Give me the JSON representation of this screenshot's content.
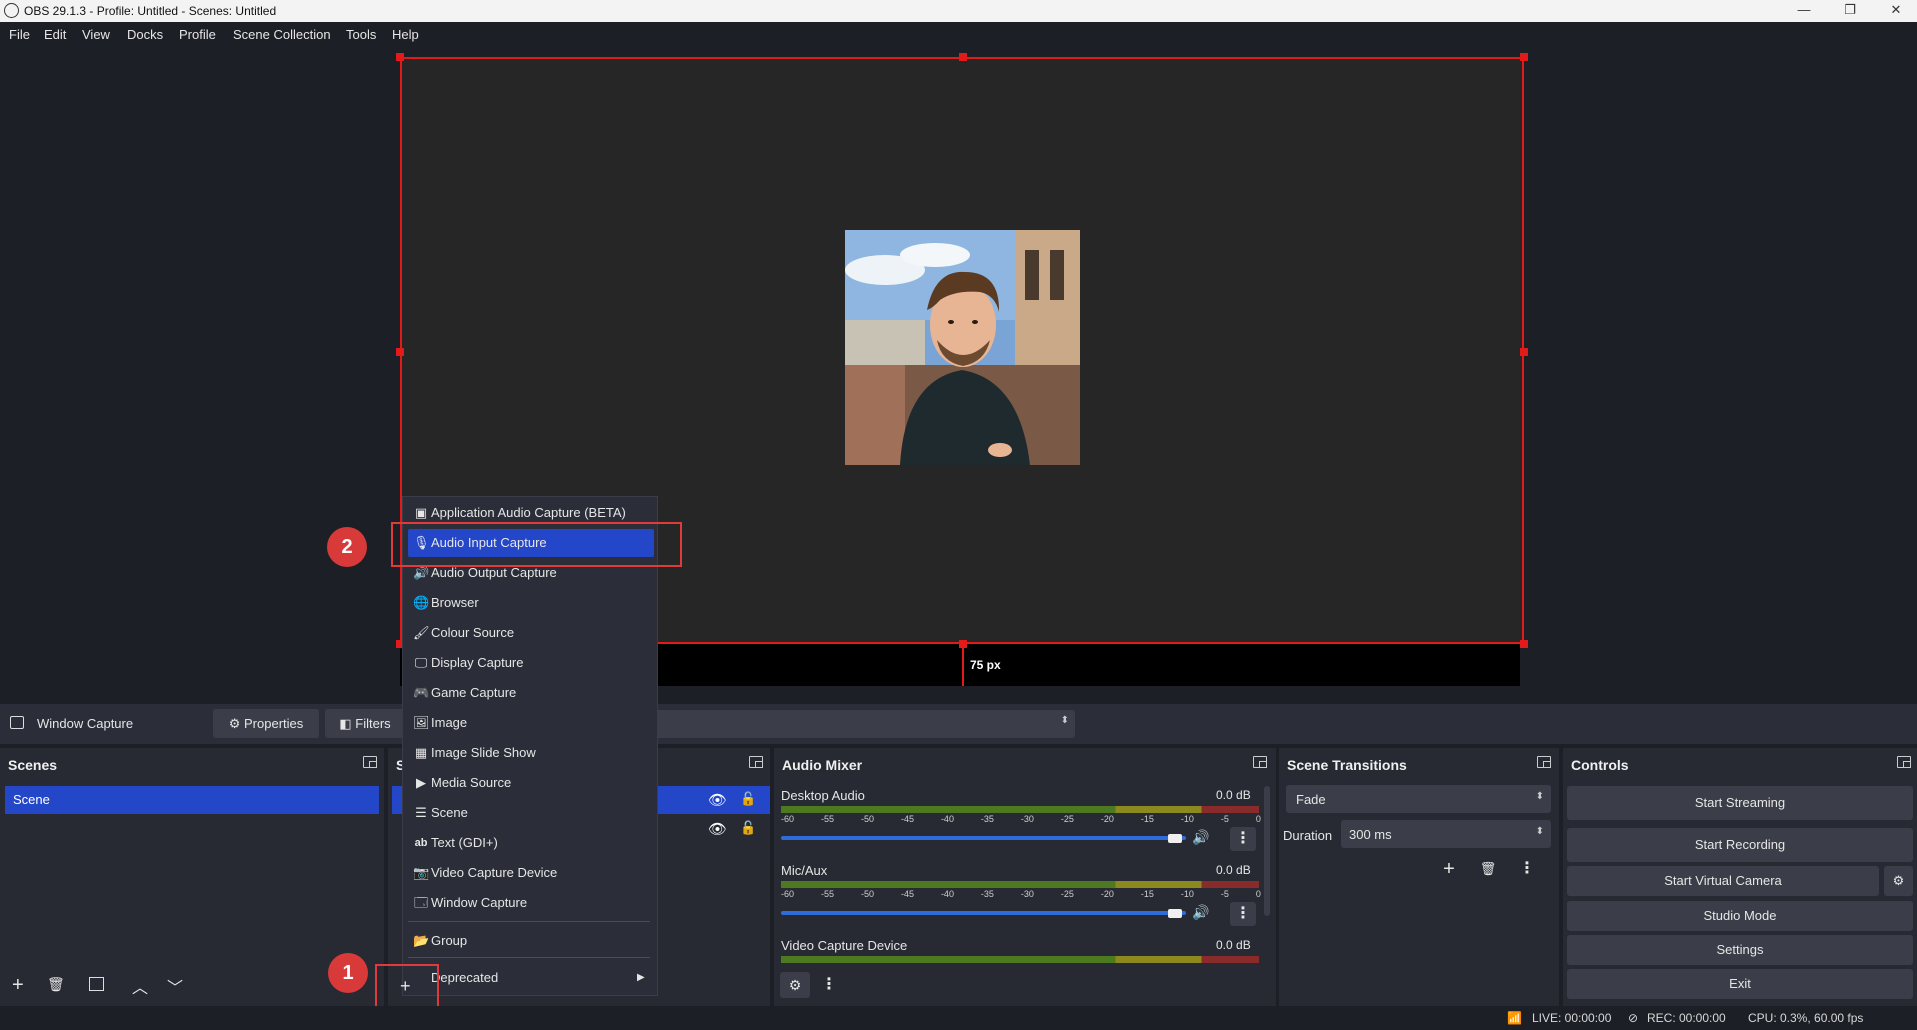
{
  "window": {
    "title": "OBS 29.1.3 - Profile: Untitled - Scenes: Untitled",
    "minimize": "—",
    "maximize": "❐",
    "close": "✕"
  },
  "menubar": [
    "File",
    "Edit",
    "View",
    "Docks",
    "Profile",
    "Scene Collection",
    "Tools",
    "Help"
  ],
  "preview": {
    "guide_label": "75 px"
  },
  "source_toolbar": {
    "selected_source": "Window Capture",
    "properties": "Properties",
    "filters": "Filters"
  },
  "scenes": {
    "title": "Scenes",
    "items": [
      "Scene"
    ]
  },
  "sources": {
    "title": "S"
  },
  "audio_mixer": {
    "title": "Audio Mixer",
    "scale": [
      "-60",
      "-55",
      "-50",
      "-45",
      "-40",
      "-35",
      "-30",
      "-25",
      "-20",
      "-15",
      "-10",
      "-5",
      "0"
    ],
    "channels": [
      {
        "name": "Desktop Audio",
        "db": "0.0 dB"
      },
      {
        "name": "Mic/Aux",
        "db": "0.0 dB"
      },
      {
        "name": "Video Capture Device",
        "db": "0.0 dB"
      }
    ]
  },
  "scene_transitions": {
    "title": "Scene Transitions",
    "transition": "Fade",
    "duration_label": "Duration",
    "duration_value": "300 ms"
  },
  "controls": {
    "title": "Controls",
    "start_streaming": "Start Streaming",
    "start_recording": "Start Recording",
    "start_virtual_camera": "Start Virtual Camera",
    "studio_mode": "Studio Mode",
    "settings": "Settings",
    "exit": "Exit"
  },
  "add_source_menu": {
    "items": [
      {
        "label": "Application Audio Capture (BETA)",
        "icon": "app-audio-icon"
      },
      {
        "label": "Audio Input Capture",
        "icon": "microphone-icon"
      },
      {
        "label": "Audio Output Capture",
        "icon": "speaker-icon"
      },
      {
        "label": "Browser",
        "icon": "globe-icon"
      },
      {
        "label": "Colour Source",
        "icon": "brush-icon"
      },
      {
        "label": "Display Capture",
        "icon": "monitor-icon"
      },
      {
        "label": "Game Capture",
        "icon": "gamepad-icon"
      },
      {
        "label": "Image",
        "icon": "image-icon"
      },
      {
        "label": "Image Slide Show",
        "icon": "slideshow-icon"
      },
      {
        "label": "Media Source",
        "icon": "play-icon"
      },
      {
        "label": "Scene",
        "icon": "list-icon"
      },
      {
        "label": "Text (GDI+)",
        "icon": "text-icon"
      },
      {
        "label": "Video Capture Device",
        "icon": "camera-icon"
      },
      {
        "label": "Window Capture",
        "icon": "window-icon"
      },
      {
        "label": "Group",
        "icon": "folder-icon"
      },
      {
        "label": "Deprecated",
        "icon": "submenu-arrow-icon"
      }
    ],
    "highlighted": "Audio Input Capture"
  },
  "annotations": {
    "step1": "1",
    "step2": "2",
    "accent": "#d83a3a"
  },
  "status": {
    "live": "LIVE: 00:00:00",
    "rec": "REC: 00:00:00",
    "cpu": "CPU: 0.3%, 60.00 fps"
  },
  "colors": {
    "selection": "#2446c9",
    "bounding_box": "#e21a1a"
  }
}
